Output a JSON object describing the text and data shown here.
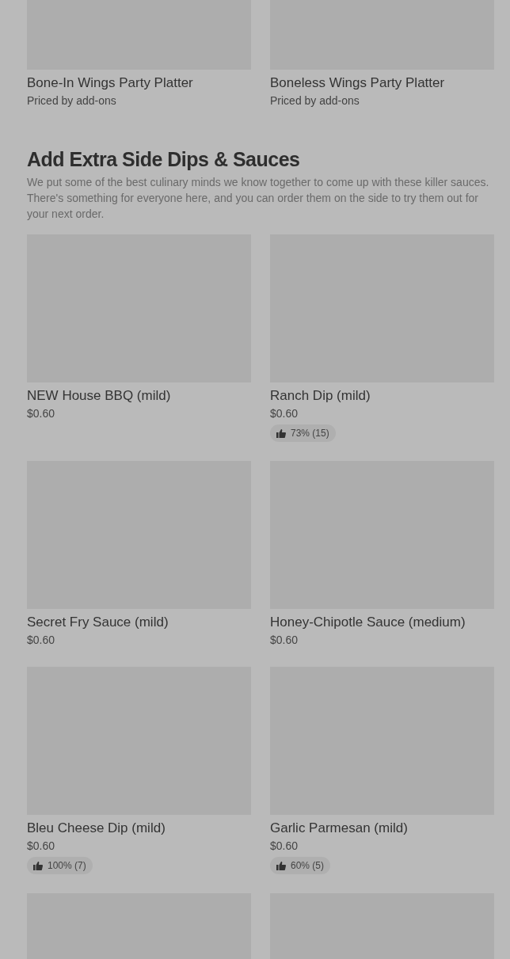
{
  "top_items": [
    {
      "name": "Bone-In Wings Party Platter",
      "price": "Priced by add-ons"
    },
    {
      "name": "Boneless Wings Party Platter",
      "price": "Priced by add-ons"
    }
  ],
  "section": {
    "title": "Add Extra Side Dips & Sauces",
    "description": "We put some of the best culinary minds we know together to come up with these killer sauces. There's something for everyone here, and you can order them on the side to try them out for your next order.",
    "items": [
      {
        "name": "NEW House BBQ (mild)",
        "price": "$0.60"
      },
      {
        "name": "Ranch Dip (mild)",
        "price": "$0.60",
        "rating": "73% (15)"
      },
      {
        "name": "Secret Fry Sauce (mild)",
        "price": "$0.60"
      },
      {
        "name": "Honey-Chipotle Sauce (medium)",
        "price": "$0.60"
      },
      {
        "name": "Bleu Cheese Dip (mild)",
        "price": "$0.60",
        "rating": "100% (7)"
      },
      {
        "name": "Garlic Parmesan (mild)",
        "price": "$0.60",
        "rating": "60% (5)"
      }
    ]
  }
}
